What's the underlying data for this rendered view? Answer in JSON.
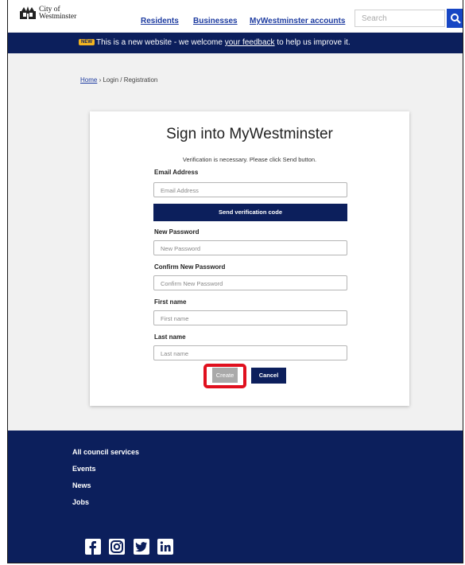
{
  "header": {
    "logo_line1": "City of",
    "logo_line2": "Westminster",
    "nav": [
      "Residents",
      "Businesses",
      "MyWestminster accounts"
    ],
    "search_placeholder": "Search"
  },
  "banner": {
    "badge": "NEW",
    "text_before": "This is a new website - we welcome ",
    "link": "your feedback",
    "text_after": " to help us improve it."
  },
  "breadcrumb": {
    "home": "Home",
    "separator": " › ",
    "current": "Login / Registration"
  },
  "form": {
    "title": "Sign into MyWestminster",
    "info": "Verification is necessary. Please click Send button.",
    "email_label": "Email Address",
    "email_placeholder": "Email Address",
    "send_button": "Send verification code",
    "new_password_label": "New Password",
    "new_password_placeholder": "New Password",
    "confirm_password_label": "Confirm New Password",
    "confirm_password_placeholder": "Confirm New Password",
    "first_name_label": "First name",
    "first_name_placeholder": "First name",
    "last_name_label": "Last name",
    "last_name_placeholder": "Last name",
    "create_button": "Create",
    "cancel_button": "Cancel"
  },
  "footer": {
    "links": [
      "All council services",
      "Events",
      "News",
      "Jobs"
    ],
    "social_icons": [
      "facebook-icon",
      "instagram-icon",
      "twitter-icon",
      "linkedin-icon"
    ]
  },
  "colors": {
    "navy": "#0c1f5c",
    "link_blue": "#1d3ba0",
    "search_blue": "#1746c4",
    "badge_yellow": "#f4b520",
    "highlight_red": "#e0101e",
    "disabled_grey": "#a9a9a9"
  }
}
